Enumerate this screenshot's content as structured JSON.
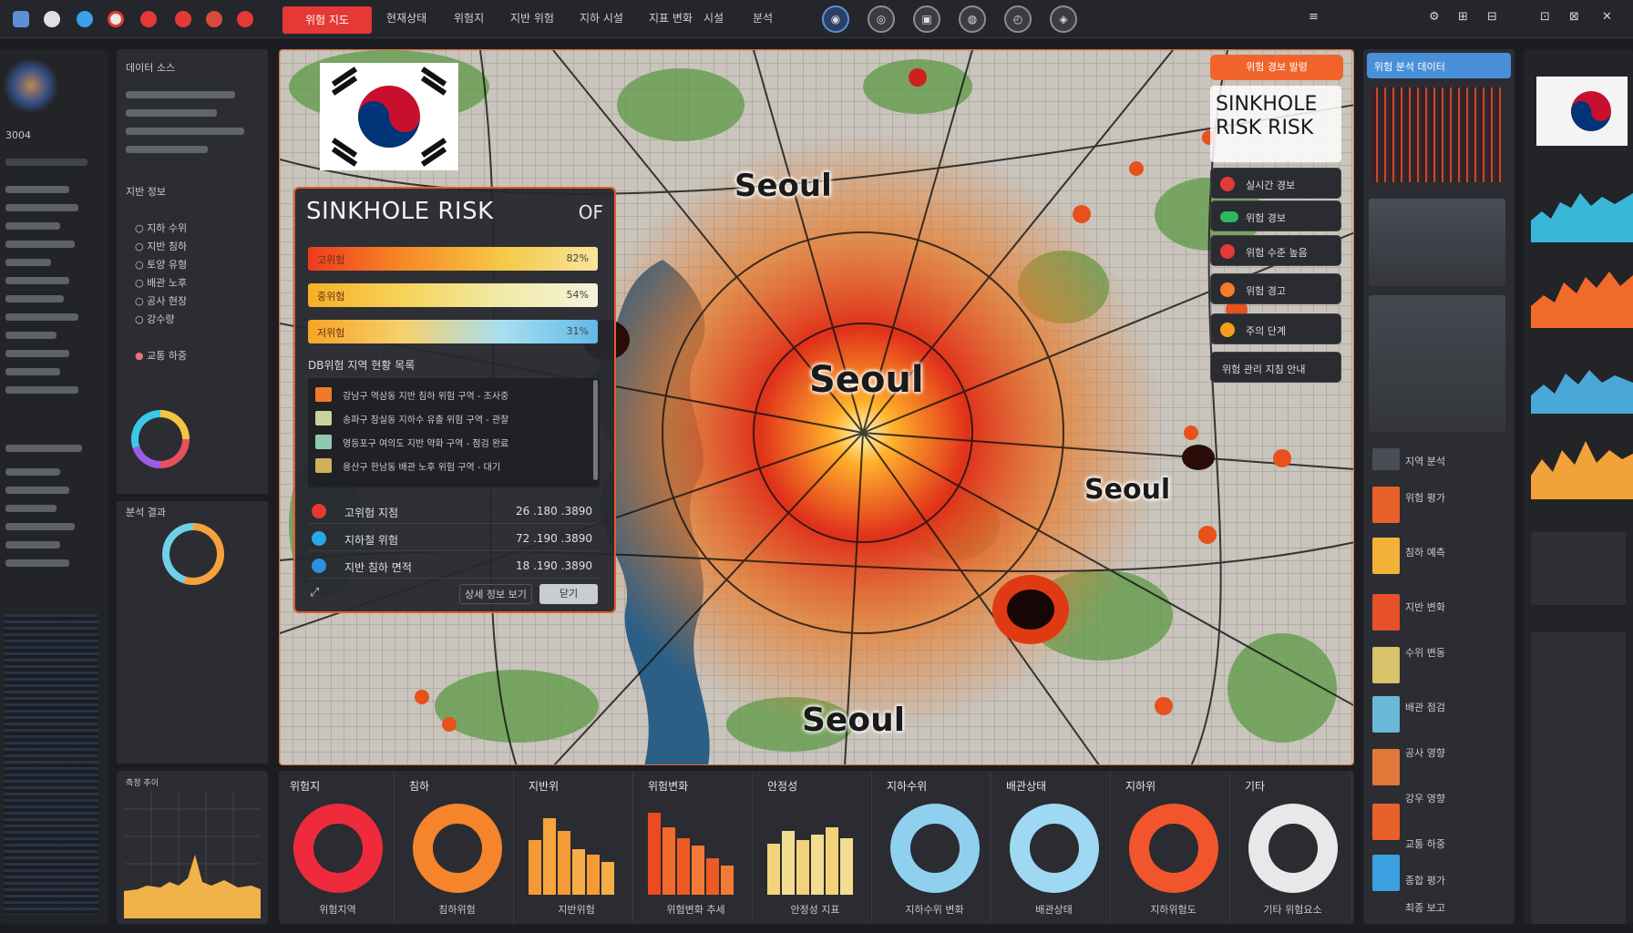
{
  "topbar": {
    "active_tab": "위험 지도",
    "menu": [
      "현재상태",
      "위험지",
      "지반 위험",
      "지하 시설",
      "지표 변화",
      "시설",
      "분석"
    ],
    "tool_icons": [
      "globe-icon",
      "pin-icon",
      "lock-icon",
      "coin-icon",
      "clock-icon",
      "layers-icon"
    ],
    "right_icons": [
      "≡",
      "⚙",
      "⊞",
      "⊟",
      "⊡",
      "⊠",
      "✕"
    ]
  },
  "left_sidebar": {
    "header": "데이터 소스",
    "section1": "지반 정보",
    "items": [
      "지하 수위",
      "지반 침하",
      "토양 유형",
      "배관 노후",
      "공사 현장",
      "강수량",
      "교통 하중"
    ],
    "section2": "분석 결과",
    "section3": "측정 추이"
  },
  "map": {
    "labels": [
      "Seoul",
      "Seoul",
      "Seoul",
      "Seoul"
    ],
    "accent": "#e55a2b"
  },
  "overlay": {
    "title": "SINKHOLE RISK",
    "tag": "OF",
    "bars": [
      {
        "label": "고위험",
        "value": "82%"
      },
      {
        "label": "중위험",
        "value": "54%"
      },
      {
        "label": "저위험",
        "value": "31%"
      }
    ],
    "list_title": "DB위험 지역 현황 목록",
    "list_rows": [
      "강남구 역삼동 지반 침하 위험 구역 - 조사중",
      "송파구 잠실동 지하수 유출 위험 구역 - 관찰",
      "영등포구 여의도 지반 약화 구역 - 점검 완료",
      "용산구 한남동 배관 노후 위험 구역 - 대기"
    ],
    "stats": [
      {
        "name": "고위험 지점",
        "value": "26 .180 .3890"
      },
      {
        "name": "지하철 위험",
        "value": "72 .190 .3890"
      },
      {
        "name": "지반 침하 면적",
        "value": "18 .190 .3890"
      }
    ],
    "footer_left": "상세 정보 보기",
    "footer_right": "닫기"
  },
  "legend": {
    "button": "위험 경보 발령",
    "title": "SINKHOLE\nRISK RISK",
    "top_item": "실시간 경보",
    "items": [
      "위험 경보",
      "위험 수준 높음",
      "위험 경고",
      "주의 단계"
    ],
    "last": "위험 관리 지침 안내"
  },
  "gauges": [
    {
      "title": "위험지",
      "footer": "위험지역",
      "type": "ring",
      "color": "#ee2a3c"
    },
    {
      "title": "침하",
      "footer": "침하위험",
      "type": "ring",
      "color": "#f5842a"
    },
    {
      "title": "지반위",
      "footer": "지반위험",
      "type": "bars",
      "color": "#f59a36"
    },
    {
      "title": "위험변화",
      "footer": "위험변화 추세",
      "type": "bars",
      "color": "#ee5a24"
    },
    {
      "title": "안정성",
      "footer": "안정성 지표",
      "type": "bars",
      "color": "#f2d27a"
    },
    {
      "title": "지하수위",
      "footer": "지하수위 변화",
      "type": "ring",
      "color": "#8fd0ee"
    },
    {
      "title": "배관상태",
      "footer": "배관상태",
      "type": "ring",
      "color": "#9fd8f2"
    },
    {
      "title": "지하위",
      "footer": "지하위험도",
      "type": "ring",
      "color": "#f2552c"
    },
    {
      "title": "기타",
      "footer": "기타 위험요소",
      "type": "ring",
      "color": "#e8e8e8"
    }
  ],
  "right_panel": {
    "header": "위험 분석 데이터",
    "rows": [
      "지역 분석",
      "위험 평가",
      "침하 예측",
      "지반 변화",
      "수위 변동",
      "배관 점검",
      "공사 영향",
      "강우 영향",
      "교통 하중",
      "종합 평가",
      "최종 보고"
    ]
  }
}
